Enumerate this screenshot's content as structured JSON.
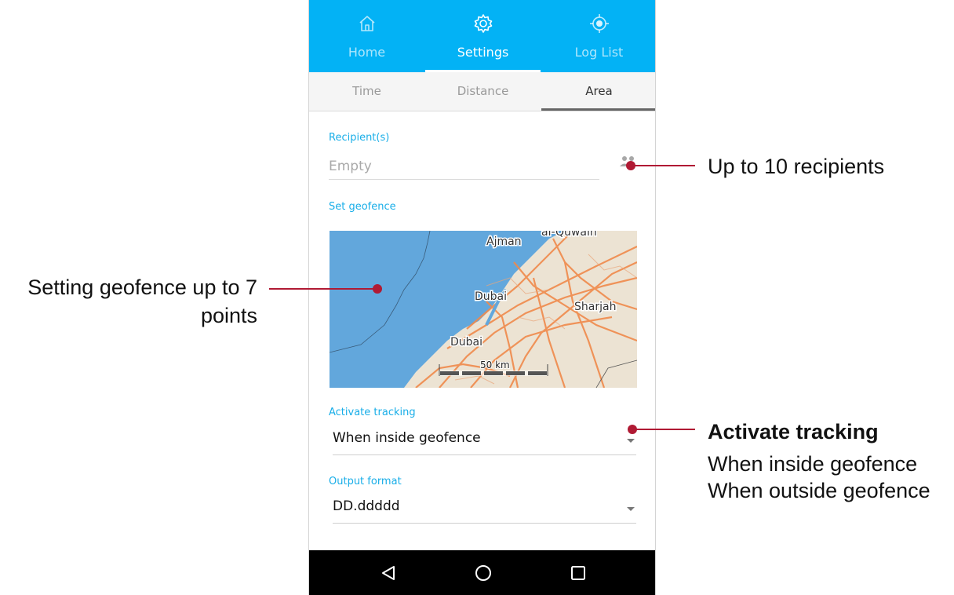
{
  "top_tabs": [
    {
      "label": "Home",
      "icon": "home-icon"
    },
    {
      "label": "Settings",
      "icon": "gear-icon",
      "active": true
    },
    {
      "label": "Log List",
      "icon": "crosshair-icon"
    }
  ],
  "sub_tabs": [
    {
      "label": "Time"
    },
    {
      "label": "Distance"
    },
    {
      "label": "Area",
      "active": true
    }
  ],
  "recipients": {
    "label": "Recipient(s)",
    "placeholder": "Empty",
    "icon": "contacts-icon"
  },
  "geofence": {
    "label": "Set geofence",
    "map_labels": {
      "ajman": "Ajman",
      "umm_al_quwain": "al-Quwain",
      "dubai_1": "Dubai",
      "sharjah": "Sharjah",
      "dubai_2": "Dubai",
      "scale": "50 km"
    }
  },
  "activate_tracking": {
    "label": "Activate tracking",
    "value": "When inside geofence"
  },
  "output_format": {
    "label": "Output format",
    "value": "DD.ddddd"
  },
  "nav_buttons": [
    "back-icon",
    "home-circle-icon",
    "recents-icon"
  ],
  "annotations": {
    "recipients_note": "Up to 10 recipients",
    "geofence_note_line1": "Setting geofence up to 7",
    "geofence_note_line2": "points",
    "tracking_title": "Activate tracking",
    "tracking_opt1": "When inside geofence",
    "tracking_opt2": "When outside geofence"
  },
  "colors": {
    "accent": "#03b2f5",
    "annotation": "#b01a34",
    "water": "#62a7dc",
    "land": "#ece3d3",
    "roads": "#f08a4b"
  }
}
